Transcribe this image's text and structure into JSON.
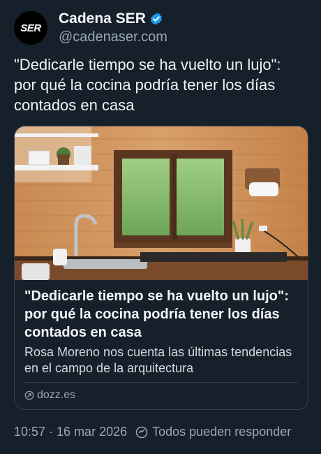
{
  "account": {
    "avatar_text": "SER",
    "display_name": "Cadena SER",
    "handle": "@cadenaser.com",
    "verified_icon": "verified-badge-icon"
  },
  "post": {
    "text": "\"Dedicarle tiempo se ha vuelto un lujo\": por qué la cocina podría tener los días contados en casa"
  },
  "link_card": {
    "image": "kitchen-photo",
    "title": "\"Dedicarle tiempo se ha vuelto un lujo\": por qué la cocina podría tener los días contados en casa",
    "description": "Rosa Moreno nos cuenta las últimas tendencias en el campo de la arquitectura",
    "domain": "dozz.es"
  },
  "meta": {
    "timestamp": "10:57 · 16 mar 2026",
    "reply_setting": "Todos pueden responder"
  },
  "colors": {
    "background": "#15202b",
    "verified": "#1d9bf0",
    "secondary_text": "#9aa7b3"
  }
}
